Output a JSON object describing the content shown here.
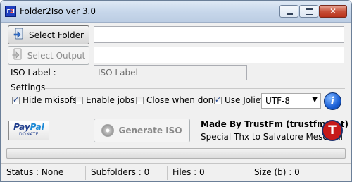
{
  "window": {
    "title": "Folder2Iso ver 3.0",
    "icon_text_a": "F",
    "icon_text_b": "2",
    "icon_text_c": "I",
    "controls": {
      "minimize": "minimize-icon",
      "maximize": "maximize-icon",
      "close": "✕"
    }
  },
  "buttons": {
    "select_folder": "Select Folder",
    "select_output": "Select Output",
    "generate_iso": "Generate ISO"
  },
  "fields": {
    "folder_path": "",
    "output_path": "",
    "iso_label_label": "ISO Label :",
    "iso_label_value": "ISO Label"
  },
  "settings": {
    "title": "Settings",
    "options": [
      {
        "label": "Hide mkisofs",
        "checked": true
      },
      {
        "label": "Enable jobs",
        "checked": false
      },
      {
        "label": "Close when done",
        "checked": false
      },
      {
        "label": "Use Joliet",
        "checked": true
      }
    ],
    "encoding": "UTF-8"
  },
  "credits": {
    "made_by": "Made By TrustFm (trustfm.net)",
    "thanks": "Special Thx to Salvatore Meschini",
    "logo_letter": "T",
    "paypal_pay": "Pay",
    "paypal_pal": "Pal",
    "paypal_donate": "DONATE"
  },
  "progress": {
    "value": 0
  },
  "status": {
    "status": "Status : None",
    "subfolders": "Subfolders : 0",
    "files": "Files : 0",
    "size": "Size (b) : 0"
  },
  "colors": {
    "title_bar": "#c6d6ea",
    "close_button": "#c8513a",
    "window_bg": "#f0f0f0",
    "info_icon": "#1a5fd6",
    "logo_red": "#c71a1a"
  }
}
